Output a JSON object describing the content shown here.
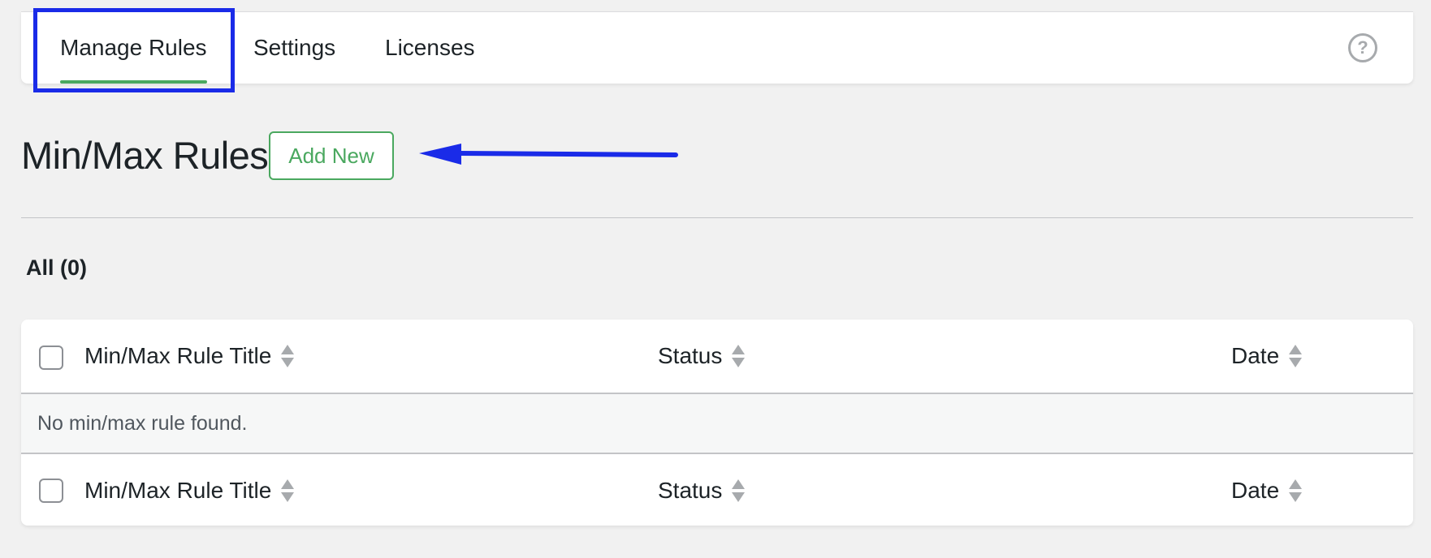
{
  "tabs": [
    {
      "label": "Manage Rules",
      "active": true
    },
    {
      "label": "Settings",
      "active": false
    },
    {
      "label": "Licenses",
      "active": false
    }
  ],
  "help": {
    "icon": "help-circle-icon",
    "glyph": "?"
  },
  "page": {
    "title": "Min/Max Rules",
    "add_new_label": "Add New"
  },
  "filters": {
    "all_label": "All (0)"
  },
  "table": {
    "columns": [
      "Min/Max Rule Title",
      "Status",
      "Date"
    ],
    "empty_message": "No min/max rule found."
  },
  "colors": {
    "accent_green": "#4aa85f",
    "annotation_blue": "#1a2be8"
  }
}
